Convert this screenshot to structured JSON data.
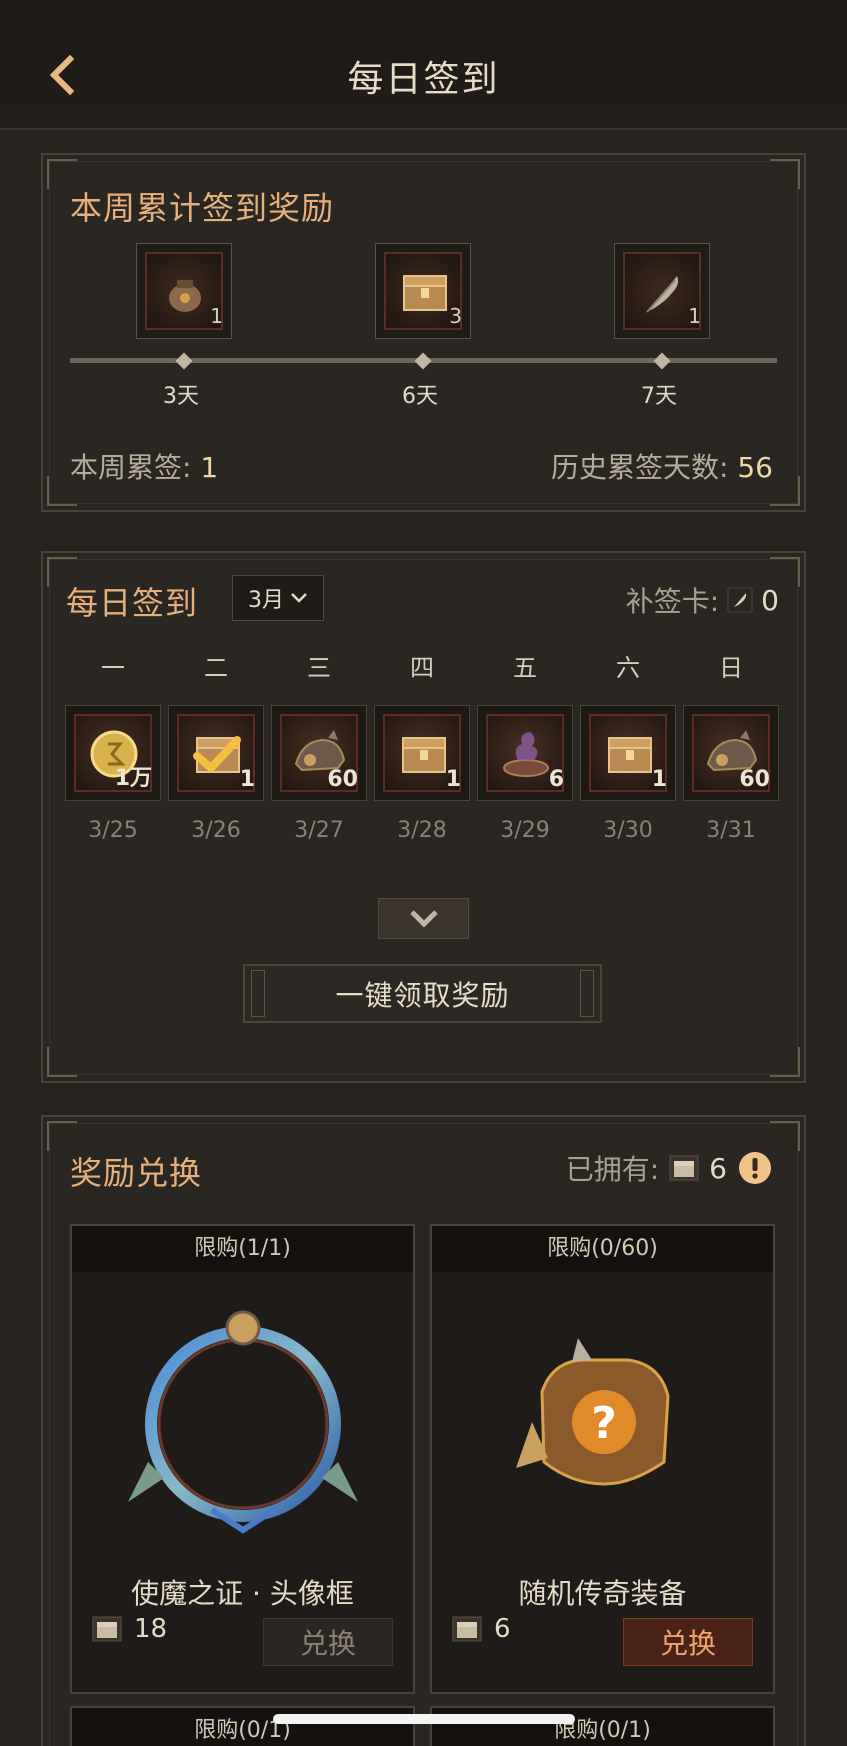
{
  "header": {
    "title": "每日签到"
  },
  "weekly": {
    "title": "本周累计签到奖励",
    "rewards": [
      {
        "icon": "pouch-icon",
        "count": "1",
        "day": "3天"
      },
      {
        "icon": "chest-icon",
        "count": "3",
        "day": "6天"
      },
      {
        "icon": "feather-icon",
        "count": "1",
        "day": "7天"
      }
    ],
    "week_label": "本周累签:",
    "week_value": "1",
    "history_label": "历史累签天数:",
    "history_value": "56"
  },
  "daily": {
    "title": "每日签到",
    "month": "3月",
    "makeup_label": "补签卡:",
    "makeup_value": "0",
    "weekdays": [
      "一",
      "二",
      "三",
      "四",
      "五",
      "六",
      "日"
    ],
    "days": [
      {
        "date": "3/25",
        "count": "1万",
        "icon": "gold-coin-icon",
        "checked": false
      },
      {
        "date": "3/26",
        "count": "1",
        "icon": "chest-icon",
        "checked": true
      },
      {
        "date": "3/27",
        "count": "60",
        "icon": "armor-icon",
        "checked": false
      },
      {
        "date": "3/28",
        "count": "1",
        "icon": "chest-icon",
        "checked": false
      },
      {
        "date": "3/29",
        "count": "6",
        "icon": "smoke-bowl-icon",
        "checked": false
      },
      {
        "date": "3/30",
        "count": "1",
        "icon": "chest-icon",
        "checked": false
      },
      {
        "date": "3/31",
        "count": "60",
        "icon": "armor-icon",
        "checked": false
      }
    ],
    "claim_all": "一键领取奖励"
  },
  "exchange": {
    "title": "奖励兑换",
    "owned_label": "已拥有:",
    "owned_value": "6",
    "items": [
      {
        "limit": "限购(1/1)",
        "name": "使魔之证 · 头像框",
        "cost": "18",
        "button": "兑换",
        "enabled": false
      },
      {
        "limit": "限购(0/60)",
        "name": "随机传奇装备",
        "cost": "6",
        "button": "兑换",
        "enabled": true
      }
    ],
    "next_row": [
      {
        "limit": "限购(0/1)"
      },
      {
        "limit": "限购(0/1)"
      }
    ]
  },
  "colors": {
    "accent": "#e6b07c",
    "panel": "#2a2621",
    "background": "#26221d"
  }
}
